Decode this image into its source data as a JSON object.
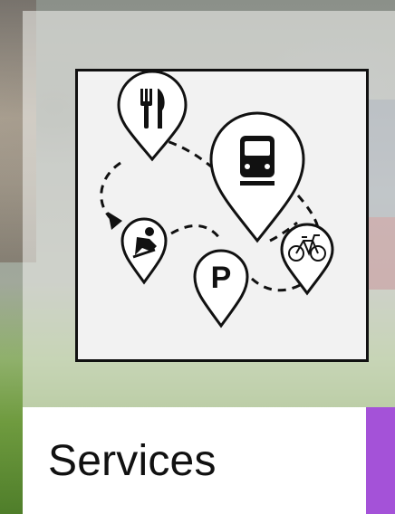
{
  "card": {
    "title": "Services",
    "accent_color": "#a452d8"
  },
  "illustration": {
    "icons": [
      "fork-knife-icon",
      "train-icon",
      "bicycle-icon",
      "parking-icon",
      "skateboarder-icon"
    ],
    "parking_letter": "P"
  }
}
